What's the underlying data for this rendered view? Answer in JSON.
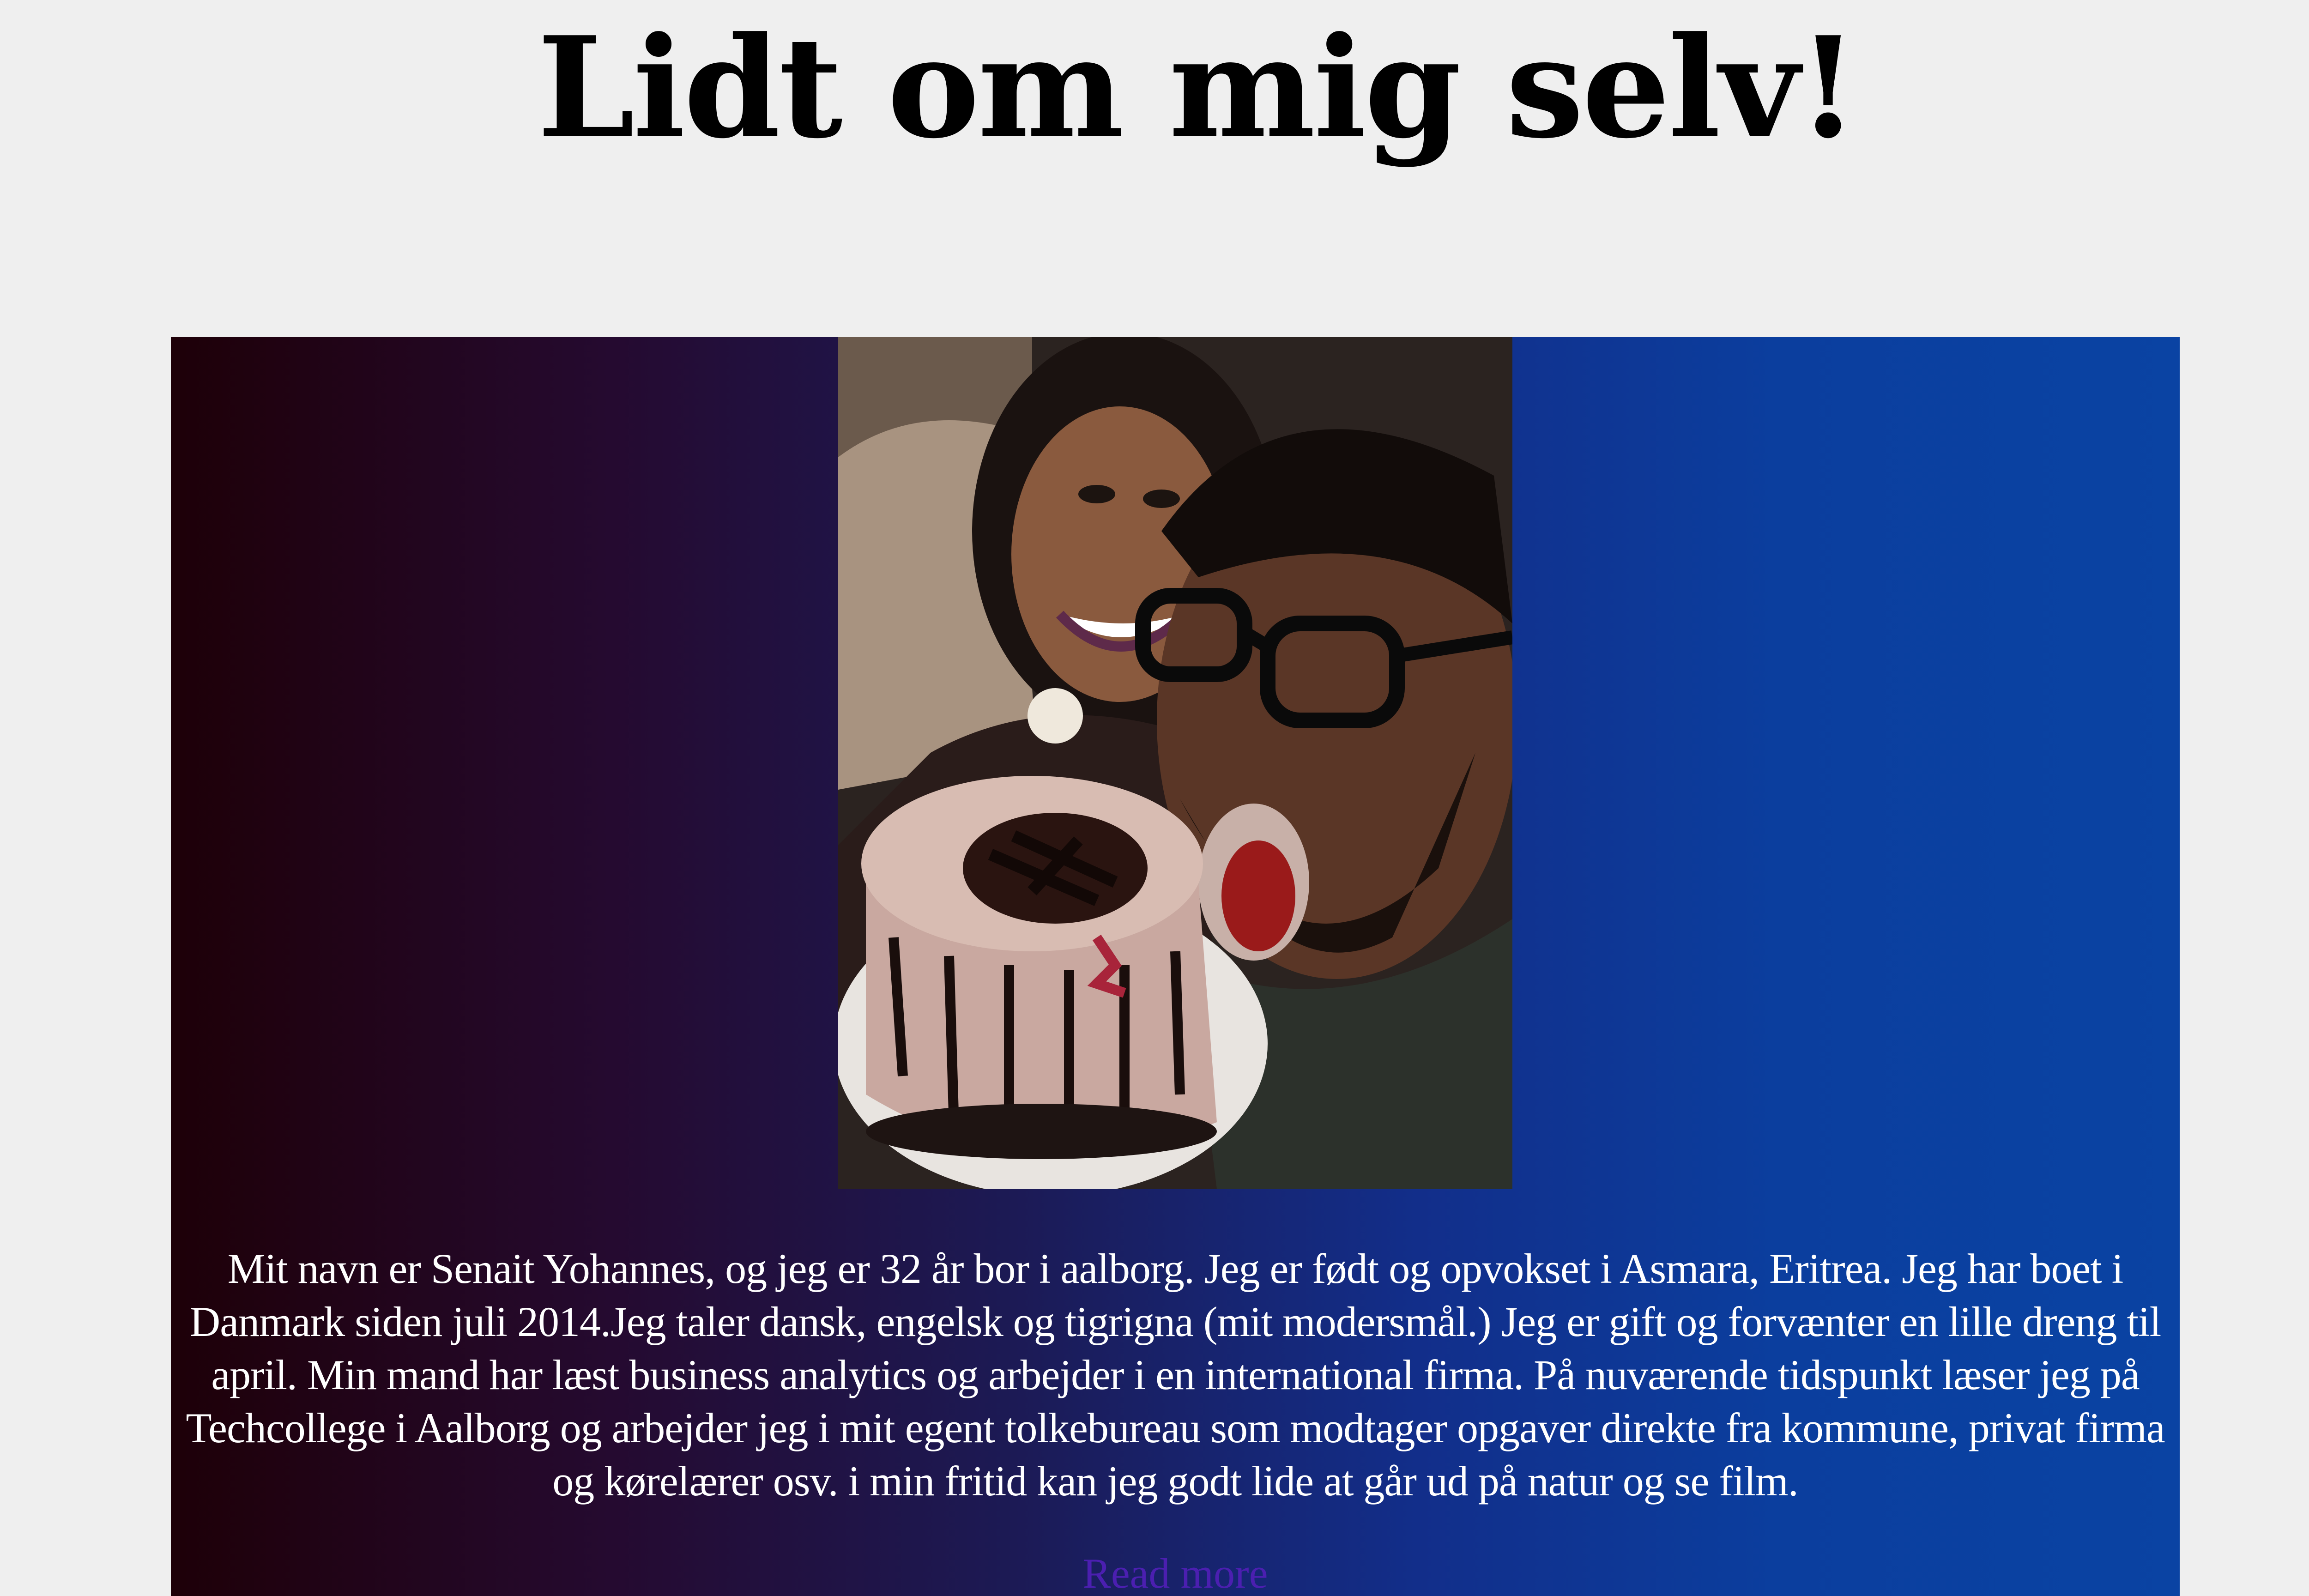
{
  "page": {
    "title": "Lidt om mig selv!"
  },
  "about": {
    "bio": "Mit navn er Senait Yohannes, og jeg er 32 år bor i aalborg. Jeg er født og opvokset i Asmara, Eritrea. Jeg har boet i Danmark siden juli 2014.Jeg taler dansk, engelsk og tigrigna (mit modersmål.) Jeg er gift og forvænter en lille dreng til april. Min mand har læst business analytics og arbejder i en international firma. På nuværende tidspunkt læser jeg på Techcollege i Aalborg og arbejder jeg i mit egent tolkebureau som modtager opgaver direkte fra kommune, privat firma og kørelærer osv. i min fritid kan jeg godt lide at går ud på natur og se film.",
    "read_more_label": "Read more"
  },
  "colors": {
    "page_background": "#efefef",
    "gradient_left": "#1e0008",
    "gradient_right": "#0a43a3",
    "link": "#4b1fb0",
    "text": "#ffffff"
  }
}
